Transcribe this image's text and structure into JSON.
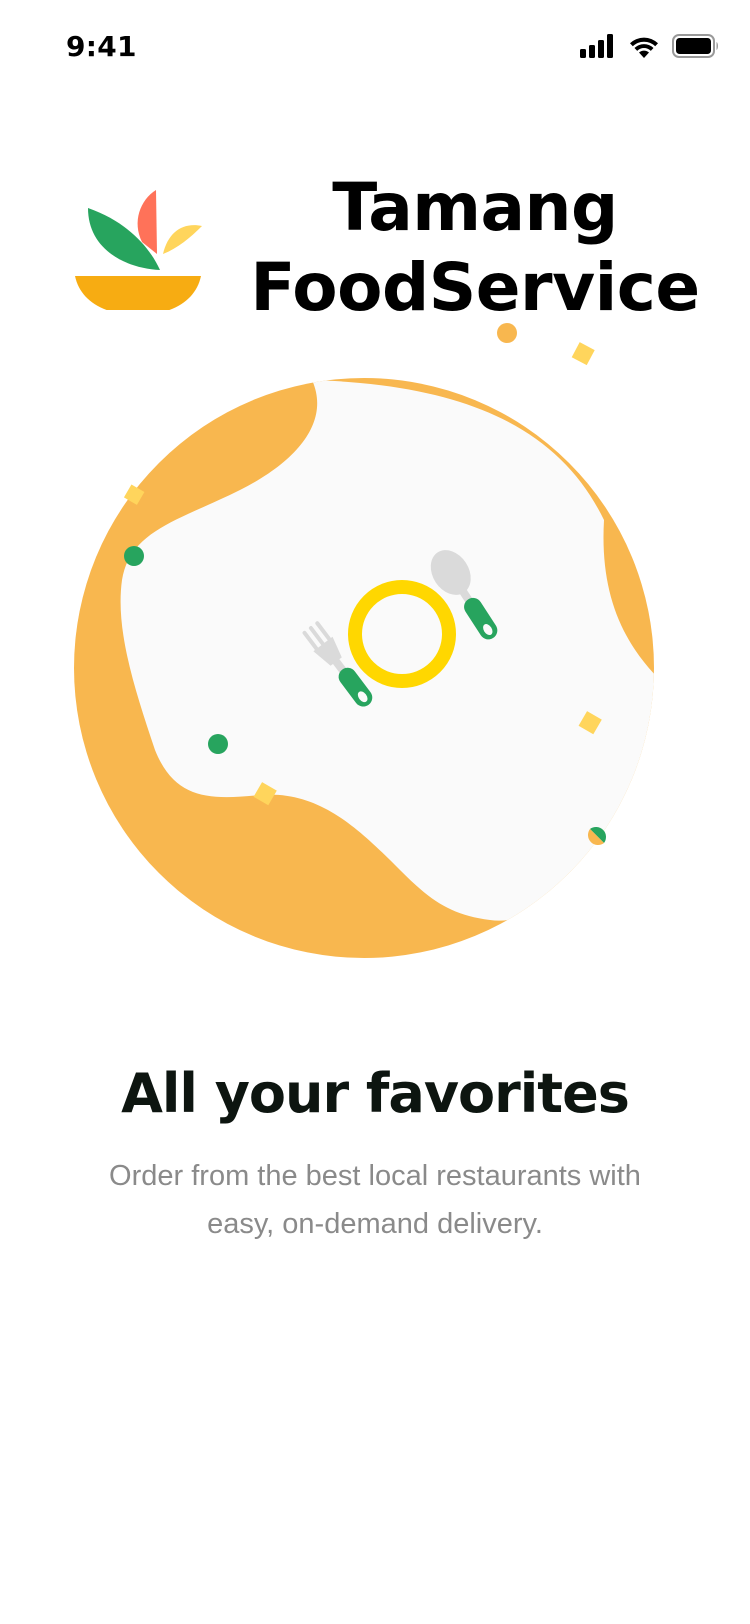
{
  "status_bar": {
    "time": "9:41",
    "icons": [
      "signal-icon",
      "wifi-icon",
      "battery-icon"
    ]
  },
  "brand": {
    "logo": "bowl-with-leaves-logo",
    "name_line1": "Tamang",
    "name_line2": "FoodService"
  },
  "hero": {
    "illustration": "plate-fork-spoon-illustration"
  },
  "onboarding": {
    "title": "All your favorites",
    "subtitle": "Order from the best local restaurants with easy, on-demand delivery."
  },
  "colors": {
    "orange": "#F8B74F",
    "green": "#27A45E",
    "yellow": "#FFD700",
    "coral": "#FF7259",
    "light_yellow": "#FFD55C",
    "bowl": "#F7AC12",
    "plate_bg": "#FAFAFA",
    "title": "#0D1510",
    "subtitle": "#8A8A8A"
  }
}
